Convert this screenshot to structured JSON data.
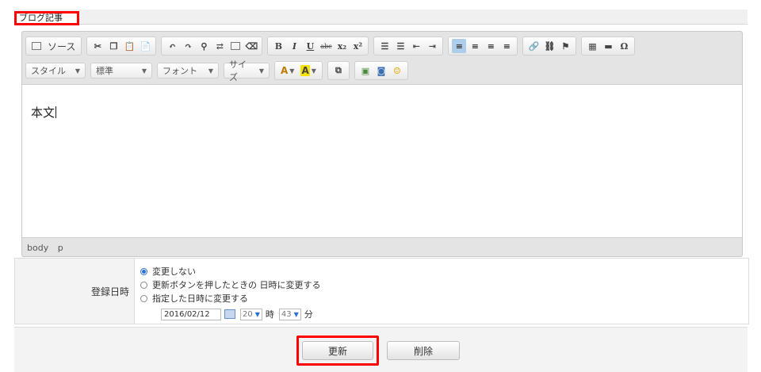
{
  "tab": {
    "label": "ブログ記事"
  },
  "toolbar": {
    "source_label": "ソース",
    "style_combo": "スタイル",
    "format_combo": "標準",
    "font_combo": "フォント",
    "size_combo": "サイズ",
    "bold": "B",
    "italic": "I",
    "underline": "U",
    "strike": "abc",
    "subscript": "x₂",
    "superscript": "x²",
    "omega": "Ω",
    "text_color_glyph": "A",
    "bg_color_glyph": "A",
    "icons_row1": [
      "source-icon",
      "cut-icon",
      "copy-icon",
      "paste-icon",
      "paste-word-icon",
      "undo-icon",
      "redo-icon",
      "find-icon",
      "replace-icon",
      "select-all-icon",
      "remove-format-icon",
      "bold-icon",
      "italic-icon",
      "underline-icon",
      "strike-icon",
      "subscript-icon",
      "superscript-icon",
      "ordered-list-icon",
      "unordered-list-icon",
      "outdent-icon",
      "indent-icon",
      "align-left-icon",
      "align-center-icon",
      "align-right-icon",
      "align-justify-icon",
      "link-icon",
      "unlink-icon",
      "anchor-icon",
      "table-icon",
      "horizontal-rule-icon",
      "special-char-icon"
    ],
    "accent_color": "#aecdea"
  },
  "editor": {
    "body_text": "本文",
    "path": [
      "body",
      "p"
    ]
  },
  "form": {
    "date_label": "登録日時",
    "options": [
      {
        "label": "変更しない",
        "checked": true
      },
      {
        "label": "更新ボタンを押したときの 日時に変更する",
        "checked": false
      },
      {
        "label": "指定した日時に変更する",
        "checked": false
      }
    ],
    "date_value": "2016/02/12",
    "hour_value": "20",
    "hour_unit": "時",
    "minute_value": "43",
    "minute_unit": "分"
  },
  "actions": {
    "update_label": "更新",
    "delete_label": "削除"
  },
  "colors": {
    "highlight_border": "#ff0000",
    "radio_selected": "#2a6fd6"
  }
}
